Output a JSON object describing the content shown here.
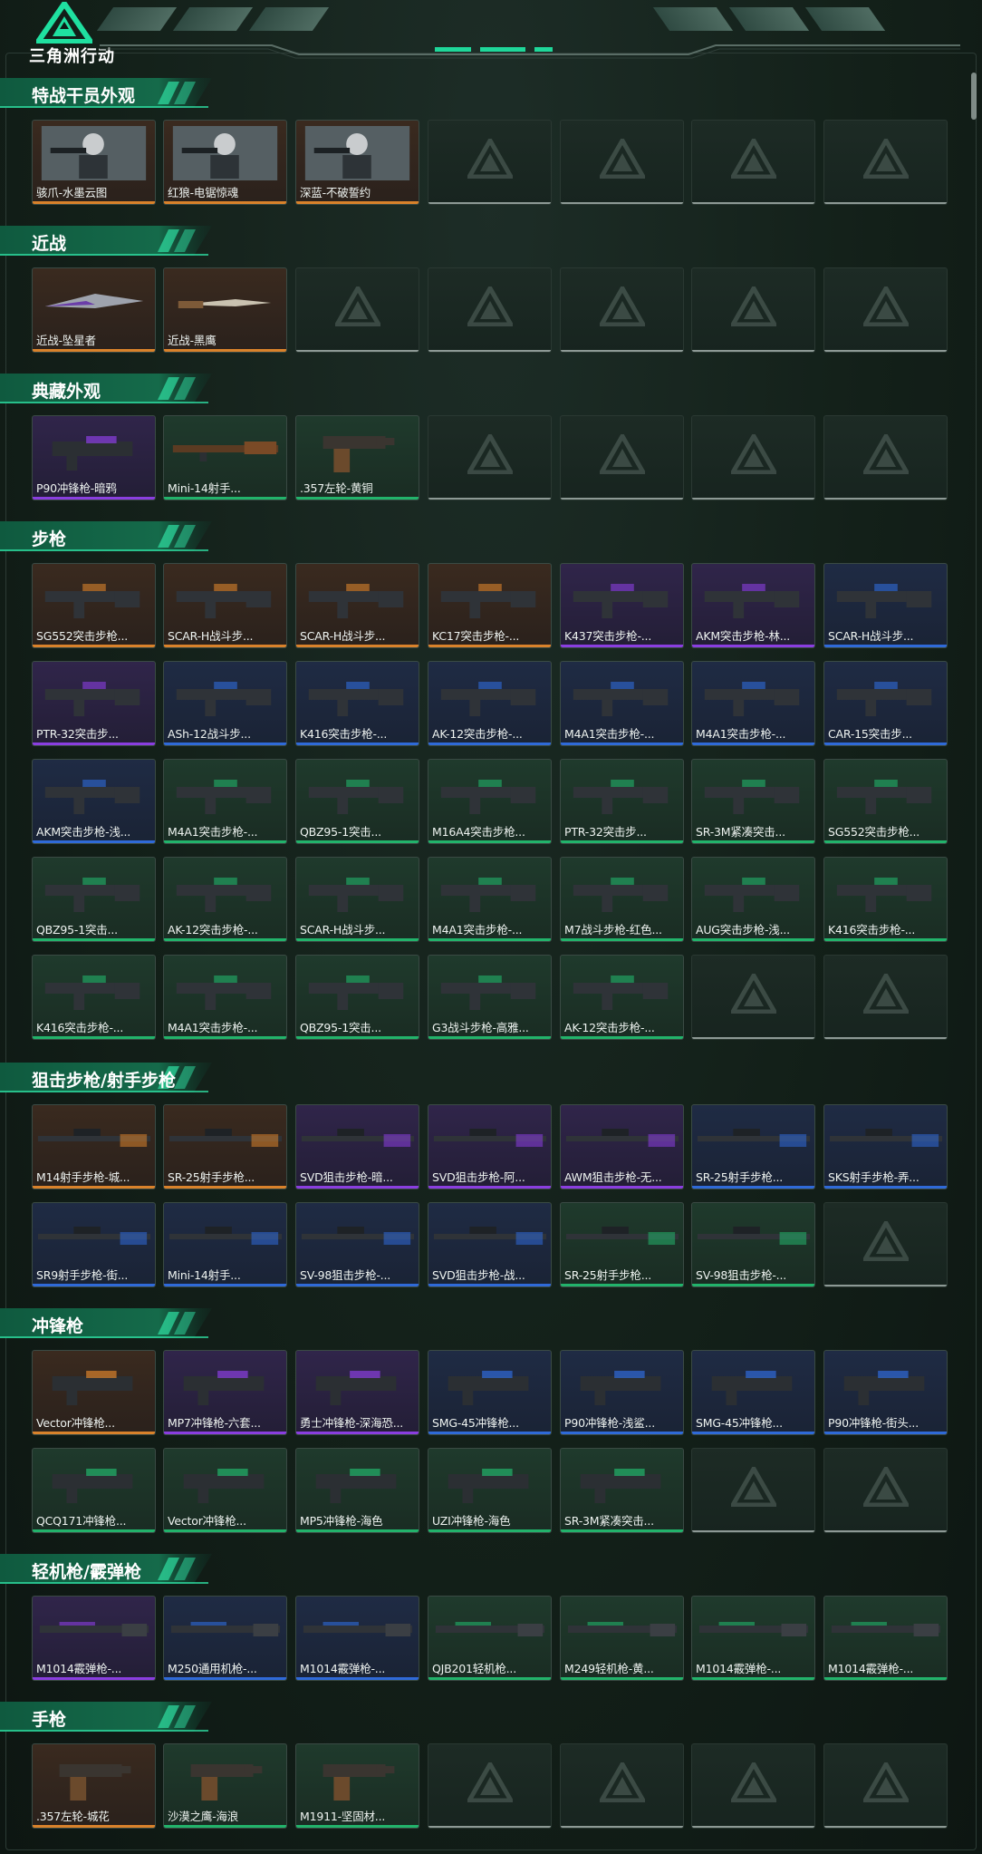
{
  "app": {
    "logo_text": "三角洲行动",
    "colors": {
      "accent": "#1fd79a",
      "gold": "#d9822b",
      "purple": "#8a3ee0",
      "blue": "#2f6ad8",
      "green": "#22b36b",
      "gray": "#8d9995"
    }
  },
  "sections": [
    {
      "title": "特战干员外观",
      "items": [
        {
          "label": "骇爪-水墨云图",
          "rarity": "gold",
          "art": "operator"
        },
        {
          "label": "红狼-电锯惊魂",
          "rarity": "gold",
          "art": "operator"
        },
        {
          "label": "深蓝-不破誓约",
          "rarity": "gold",
          "art": "operator"
        },
        {
          "label": "",
          "rarity": "empty"
        },
        {
          "label": "",
          "rarity": "empty"
        },
        {
          "label": "",
          "rarity": "empty"
        },
        {
          "label": "",
          "rarity": "empty"
        }
      ]
    },
    {
      "title": "近战",
      "items": [
        {
          "label": "近战-坠星者",
          "rarity": "gold",
          "art": "melee"
        },
        {
          "label": "近战-黑鹰",
          "rarity": "gold",
          "art": "knife"
        },
        {
          "label": "",
          "rarity": "empty"
        },
        {
          "label": "",
          "rarity": "empty"
        },
        {
          "label": "",
          "rarity": "empty"
        },
        {
          "label": "",
          "rarity": "empty"
        },
        {
          "label": "",
          "rarity": "empty"
        }
      ]
    },
    {
      "title": "典藏外观",
      "items": [
        {
          "label": "P90冲锋枪-暗鸦",
          "rarity": "purple",
          "art": "smg"
        },
        {
          "label": "Mini-14射手...",
          "rarity": "green",
          "art": "rifle"
        },
        {
          "label": ".357左轮-黄铜",
          "rarity": "green",
          "art": "pistol"
        },
        {
          "label": "",
          "rarity": "empty"
        },
        {
          "label": "",
          "rarity": "empty"
        },
        {
          "label": "",
          "rarity": "empty"
        },
        {
          "label": "",
          "rarity": "empty"
        }
      ]
    },
    {
      "title": "步枪",
      "items": [
        {
          "label": "SG552突击步枪...",
          "rarity": "gold",
          "art": "ar"
        },
        {
          "label": "SCAR-H战斗步...",
          "rarity": "gold",
          "art": "ar"
        },
        {
          "label": "SCAR-H战斗步...",
          "rarity": "gold",
          "art": "ar"
        },
        {
          "label": "KC17突击步枪-...",
          "rarity": "gold",
          "art": "ar"
        },
        {
          "label": "K437突击步枪-...",
          "rarity": "purple",
          "art": "ar"
        },
        {
          "label": "AKM突击步枪-林...",
          "rarity": "purple",
          "art": "ar"
        },
        {
          "label": "SCAR-H战斗步...",
          "rarity": "blue",
          "art": "ar"
        },
        {
          "label": "PTR-32突击步...",
          "rarity": "purple",
          "art": "ar"
        },
        {
          "label": "ASh-12战斗步...",
          "rarity": "blue",
          "art": "ar"
        },
        {
          "label": "K416突击步枪-...",
          "rarity": "blue",
          "art": "ar"
        },
        {
          "label": "AK-12突击步枪-...",
          "rarity": "blue",
          "art": "ar"
        },
        {
          "label": "M4A1突击步枪-...",
          "rarity": "blue",
          "art": "ar"
        },
        {
          "label": "M4A1突击步枪-...",
          "rarity": "blue",
          "art": "ar"
        },
        {
          "label": "CAR-15突击步...",
          "rarity": "blue",
          "art": "ar"
        },
        {
          "label": "AKM突击步枪-浅...",
          "rarity": "blue",
          "art": "ar"
        },
        {
          "label": "M4A1突击步枪-...",
          "rarity": "green",
          "art": "ar"
        },
        {
          "label": "QBZ95-1突击...",
          "rarity": "green",
          "art": "ar"
        },
        {
          "label": "M16A4突击步枪...",
          "rarity": "green",
          "art": "ar"
        },
        {
          "label": "PTR-32突击步...",
          "rarity": "green",
          "art": "ar"
        },
        {
          "label": "SR-3M紧凑突击...",
          "rarity": "green",
          "art": "ar"
        },
        {
          "label": "SG552突击步枪...",
          "rarity": "green",
          "art": "ar"
        },
        {
          "label": "QBZ95-1突击...",
          "rarity": "green",
          "art": "ar"
        },
        {
          "label": "AK-12突击步枪-...",
          "rarity": "green",
          "art": "ar"
        },
        {
          "label": "SCAR-H战斗步...",
          "rarity": "green",
          "art": "ar"
        },
        {
          "label": "M4A1突击步枪-...",
          "rarity": "green",
          "art": "ar"
        },
        {
          "label": "M7战斗步枪-红色...",
          "rarity": "green",
          "art": "ar"
        },
        {
          "label": "AUG突击步枪-浅...",
          "rarity": "green",
          "art": "ar"
        },
        {
          "label": "K416突击步枪-...",
          "rarity": "green",
          "art": "ar"
        },
        {
          "label": "K416突击步枪-...",
          "rarity": "green",
          "art": "ar"
        },
        {
          "label": "M4A1突击步枪-...",
          "rarity": "green",
          "art": "ar"
        },
        {
          "label": "QBZ95-1突击...",
          "rarity": "green",
          "art": "ar"
        },
        {
          "label": "G3战斗步枪-高雅...",
          "rarity": "green",
          "art": "ar"
        },
        {
          "label": "AK-12突击步枪-...",
          "rarity": "green",
          "art": "ar"
        },
        {
          "label": "",
          "rarity": "empty"
        },
        {
          "label": "",
          "rarity": "empty"
        }
      ]
    },
    {
      "title": "狙击步枪/射手步枪",
      "items": [
        {
          "label": "M14射手步枪-城...",
          "rarity": "gold",
          "art": "sniper"
        },
        {
          "label": "SR-25射手步枪...",
          "rarity": "gold",
          "art": "sniper"
        },
        {
          "label": "SVD狙击步枪-暗...",
          "rarity": "purple",
          "art": "sniper"
        },
        {
          "label": "SVD狙击步枪-阿...",
          "rarity": "purple",
          "art": "sniper"
        },
        {
          "label": "AWM狙击步枪-无...",
          "rarity": "purple",
          "art": "sniper"
        },
        {
          "label": "SR-25射手步枪...",
          "rarity": "blue",
          "art": "sniper"
        },
        {
          "label": "SKS射手步枪-弄...",
          "rarity": "blue",
          "art": "sniper"
        },
        {
          "label": "SR9射手步枪-街...",
          "rarity": "blue",
          "art": "sniper"
        },
        {
          "label": "Mini-14射手...",
          "rarity": "blue",
          "art": "sniper"
        },
        {
          "label": "SV-98狙击步枪-...",
          "rarity": "blue",
          "art": "sniper"
        },
        {
          "label": "SVD狙击步枪-战...",
          "rarity": "blue",
          "art": "sniper"
        },
        {
          "label": "SR-25射手步枪...",
          "rarity": "green",
          "art": "sniper"
        },
        {
          "label": "SV-98狙击步枪-...",
          "rarity": "green",
          "art": "sniper"
        },
        {
          "label": "",
          "rarity": "empty"
        }
      ]
    },
    {
      "title": "冲锋枪",
      "items": [
        {
          "label": "Vector冲锋枪...",
          "rarity": "gold",
          "art": "smg"
        },
        {
          "label": "MP7冲锋枪-六套...",
          "rarity": "purple",
          "art": "smg"
        },
        {
          "label": "勇士冲锋枪-深海恐...",
          "rarity": "purple",
          "art": "smg"
        },
        {
          "label": "SMG-45冲锋枪...",
          "rarity": "blue",
          "art": "smg"
        },
        {
          "label": "P90冲锋枪-浅鲨...",
          "rarity": "blue",
          "art": "smg"
        },
        {
          "label": "SMG-45冲锋枪...",
          "rarity": "blue",
          "art": "smg"
        },
        {
          "label": "P90冲锋枪-街头...",
          "rarity": "blue",
          "art": "smg"
        },
        {
          "label": "QCQ171冲锋枪...",
          "rarity": "green",
          "art": "smg"
        },
        {
          "label": "Vector冲锋枪...",
          "rarity": "green",
          "art": "smg"
        },
        {
          "label": "MP5冲锋枪-海色",
          "rarity": "green",
          "art": "smg"
        },
        {
          "label": "UZI冲锋枪-海色",
          "rarity": "green",
          "art": "smg"
        },
        {
          "label": "SR-3M紧凑突击...",
          "rarity": "green",
          "art": "smg"
        },
        {
          "label": "",
          "rarity": "empty"
        },
        {
          "label": "",
          "rarity": "empty"
        }
      ]
    },
    {
      "title": "轻机枪/霰弹枪",
      "items": [
        {
          "label": "M1014霰弹枪-...",
          "rarity": "purple",
          "art": "shotgun"
        },
        {
          "label": "M250通用机枪-...",
          "rarity": "blue",
          "art": "shotgun"
        },
        {
          "label": "M1014霰弹枪-...",
          "rarity": "blue",
          "art": "shotgun"
        },
        {
          "label": "QJB201轻机枪...",
          "rarity": "green",
          "art": "shotgun"
        },
        {
          "label": "M249轻机枪-黄...",
          "rarity": "green",
          "art": "shotgun"
        },
        {
          "label": "M1014霰弹枪-...",
          "rarity": "green",
          "art": "shotgun"
        },
        {
          "label": "M1014霰弹枪-...",
          "rarity": "green",
          "art": "shotgun"
        }
      ]
    },
    {
      "title": "手枪",
      "items": [
        {
          "label": ".357左轮-城花",
          "rarity": "gold",
          "art": "pistol"
        },
        {
          "label": "沙漠之鹰-海浪",
          "rarity": "green",
          "art": "pistol"
        },
        {
          "label": "M1911-坚固材...",
          "rarity": "green",
          "art": "pistol"
        },
        {
          "label": "",
          "rarity": "empty"
        },
        {
          "label": "",
          "rarity": "empty"
        },
        {
          "label": "",
          "rarity": "empty"
        },
        {
          "label": "",
          "rarity": "empty"
        }
      ]
    }
  ]
}
